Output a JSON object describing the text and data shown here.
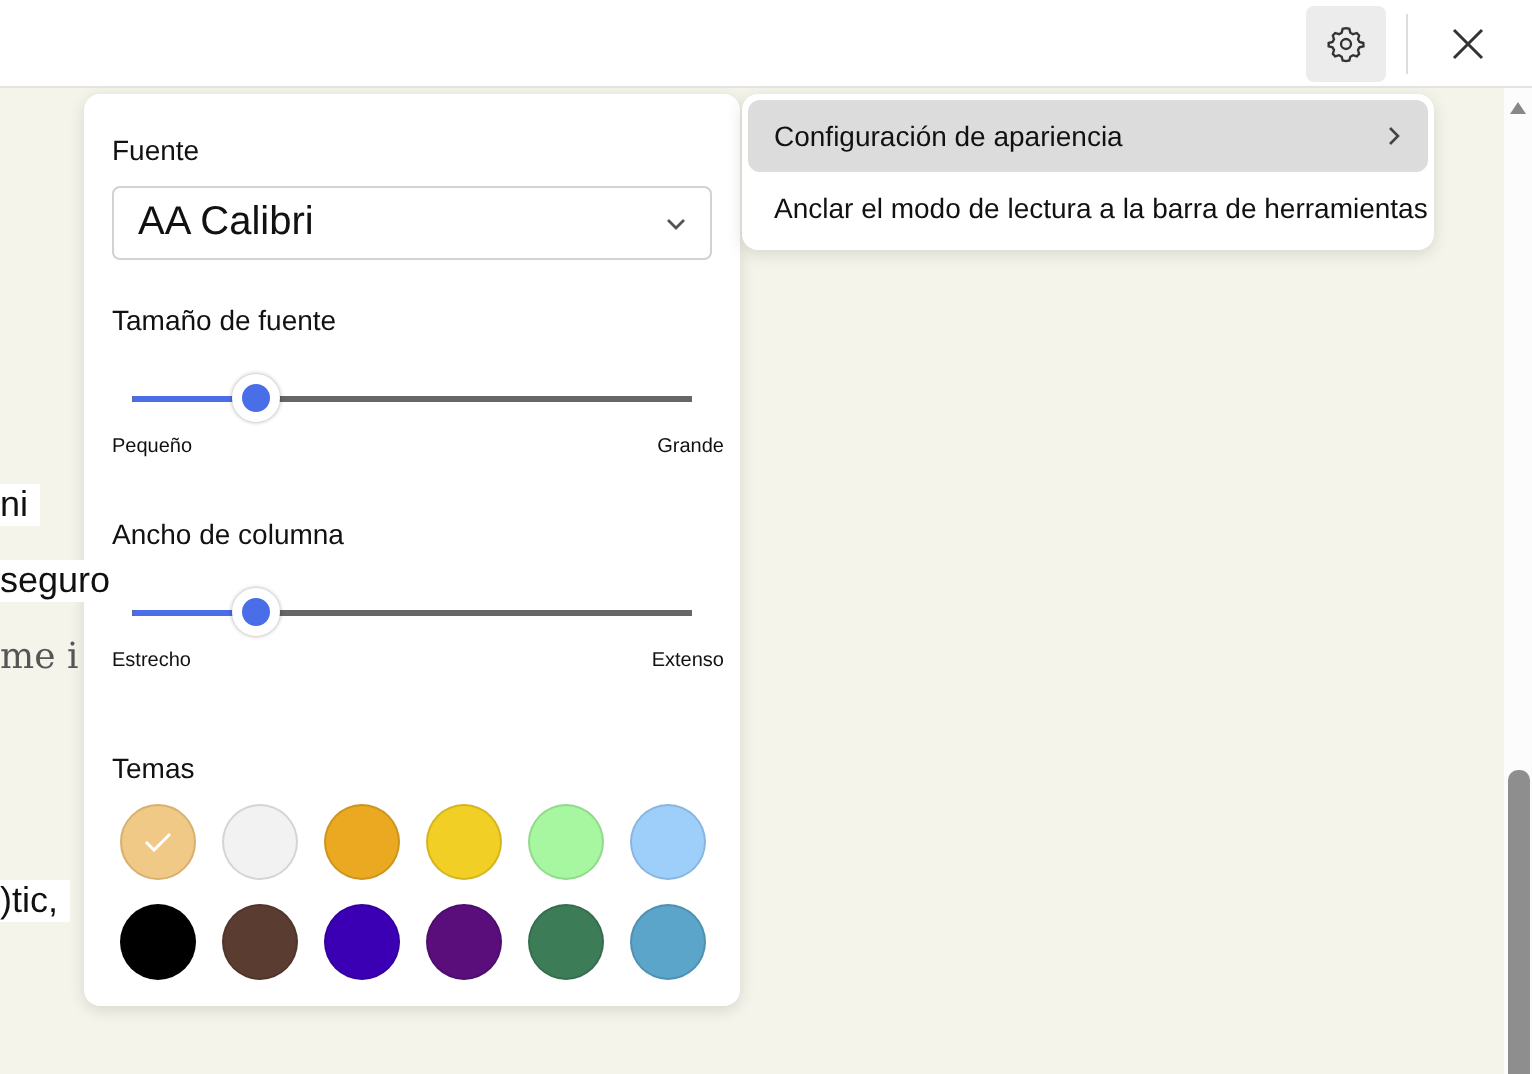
{
  "toolbar": {
    "settings_selected": true
  },
  "background_text": [
    {
      "text": "ni",
      "kind": "highlighted"
    },
    {
      "text": "seguro",
      "kind": "highlighted"
    },
    {
      "text": "me i",
      "kind": "plain"
    },
    {
      "text": ")tic,",
      "kind": "highlighted"
    }
  ],
  "panel": {
    "font_label": "Fuente",
    "font_value": "AA Calibri",
    "sliders": [
      {
        "label": "Tamaño de fuente",
        "level": 0.22,
        "min_label": "Pequeño",
        "max_label": "Grande"
      },
      {
        "label": "Ancho de columna",
        "level": 0.22,
        "min_label": "Estrecho",
        "max_label": "Extenso"
      }
    ],
    "themes_label": "Temas",
    "themes": [
      {
        "color": "#f0c987",
        "selected": true
      },
      {
        "color": "#f2f2f2",
        "selected": false
      },
      {
        "color": "#eaa921",
        "selected": false
      },
      {
        "color": "#f2cf24",
        "selected": false
      },
      {
        "color": "#a6f7a0",
        "selected": false
      },
      {
        "color": "#9ecffb",
        "selected": false
      },
      {
        "color": "#000000",
        "selected": false
      },
      {
        "color": "#5a3d30",
        "selected": false
      },
      {
        "color": "#3c00b4",
        "selected": false
      },
      {
        "color": "#590e7c",
        "selected": false
      },
      {
        "color": "#3c7d58",
        "selected": false
      },
      {
        "color": "#5aa5c9",
        "selected": false
      }
    ]
  },
  "menu": [
    {
      "label": "Configuración de apariencia",
      "selected": true,
      "submenu": true
    },
    {
      "label": "Anclar el modo de lectura a la barra de herramientas",
      "selected": false,
      "submenu": false
    }
  ]
}
